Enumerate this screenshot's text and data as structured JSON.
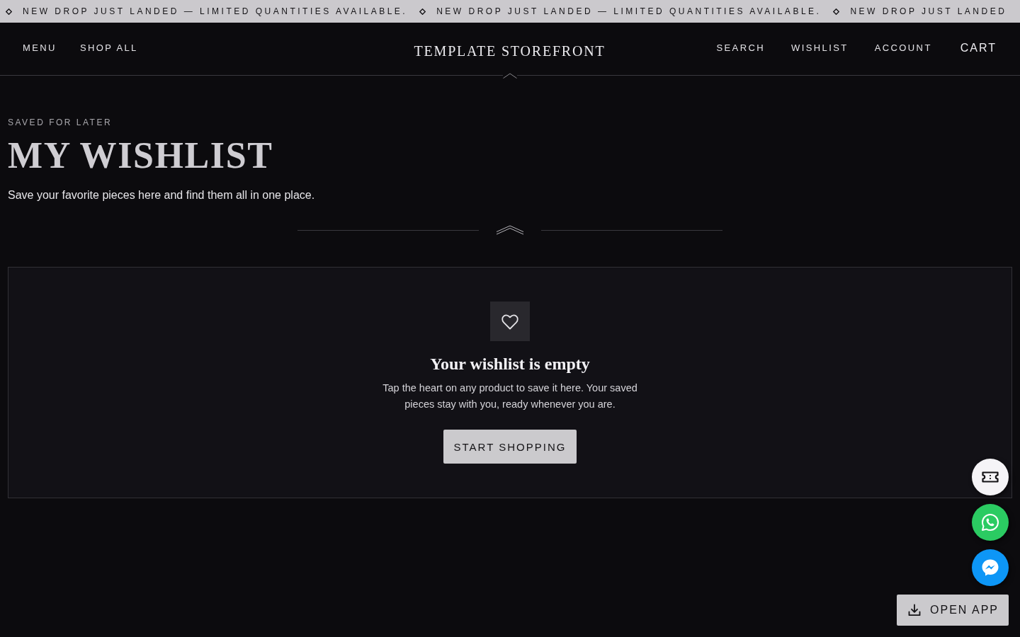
{
  "announcement_bar": {
    "items": [
      "NEW DROP JUST LANDED — LIMITED QUANTITIES AVAILABLE.",
      "NEW DROP JUST LANDED — LIMITED QUANTITIES AVAILABLE.",
      "NEW DROP JUST LANDED"
    ]
  },
  "header": {
    "left_links": [
      "MENU",
      "SHOP ALL"
    ],
    "logo": "TEMPLATE STOREFRONT",
    "right_links": [
      "SEARCH",
      "WISHLIST",
      "ACCOUNT"
    ],
    "cart": "CART"
  },
  "page_header": {
    "eyebrow": "SAVED FOR LATER",
    "title": "MY WISHLIST",
    "subtitle": "Save your favorite pieces here and find them all in one place."
  },
  "empty_state": {
    "title": "Your wishlist is empty",
    "message": "Tap the heart on any product to save it here. Your saved pieces stay with you, ready whenever you are.",
    "button": "START SHOPPING"
  },
  "app_button": {
    "label": "OPEN APP"
  }
}
